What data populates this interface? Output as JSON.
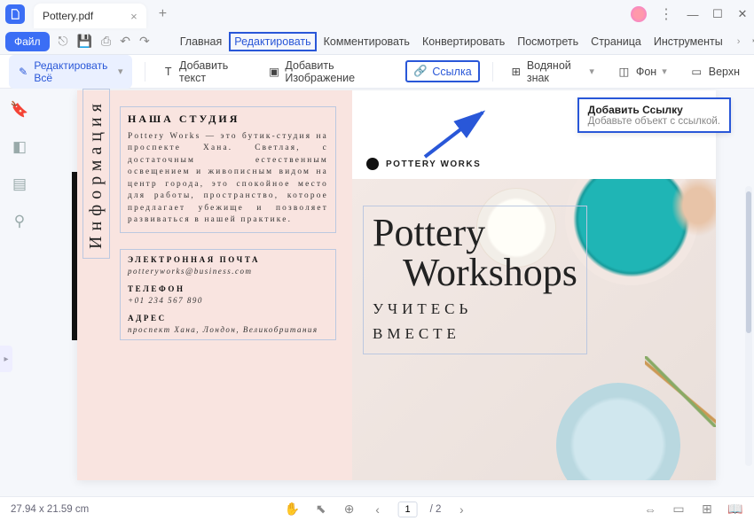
{
  "titlebar": {
    "filename": "Pottery.pdf",
    "close": "×",
    "add": "+"
  },
  "menubar": {
    "file": "Файл",
    "tabs": [
      "Главная",
      "Редактировать",
      "Комментировать",
      "Конвертировать",
      "Посмотреть",
      "Страница",
      "Инструменты"
    ]
  },
  "toolbar": {
    "edit_all": "Редактировать Всё",
    "add_text": "Добавить текст",
    "add_image": "Добавить Изображение",
    "link": "Ссылка",
    "watermark": "Водяной знак",
    "background": "Фон",
    "border": "Верхн"
  },
  "tooltip": {
    "title": "Добавить Ссылку",
    "body": "Добавьте объект с ссылкой."
  },
  "doc": {
    "vlabel": "Информация",
    "studio_title": "НАША СТУДИЯ",
    "studio_body": "Pottery Works — это бутик-студия на проспекте Хана. Светлая, с достаточным естественным освещением и живописным видом на центр города, это спокойное место для работы, пространство, которое предлагает убежище и позволяет развиваться в нашей практике.",
    "email_title": "ЭЛЕКТРОННАЯ ПОЧТА",
    "email": "potteryworks@business.com",
    "phone_title": "ТЕЛЕФОН",
    "phone": "+01 234 567 890",
    "address_title": "АДРЕС",
    "address": "проспект Хана, Лондон, Великобритания",
    "brand": "POTTERY WORKS",
    "headline1": "Pottery",
    "headline2": "Workshops",
    "sub1": "УЧИТЕСЬ",
    "sub2": "ВМЕСТЕ"
  },
  "status": {
    "dims": "27.94 x 21.59 cm",
    "page_current": "1",
    "page_total": "/ 2"
  }
}
